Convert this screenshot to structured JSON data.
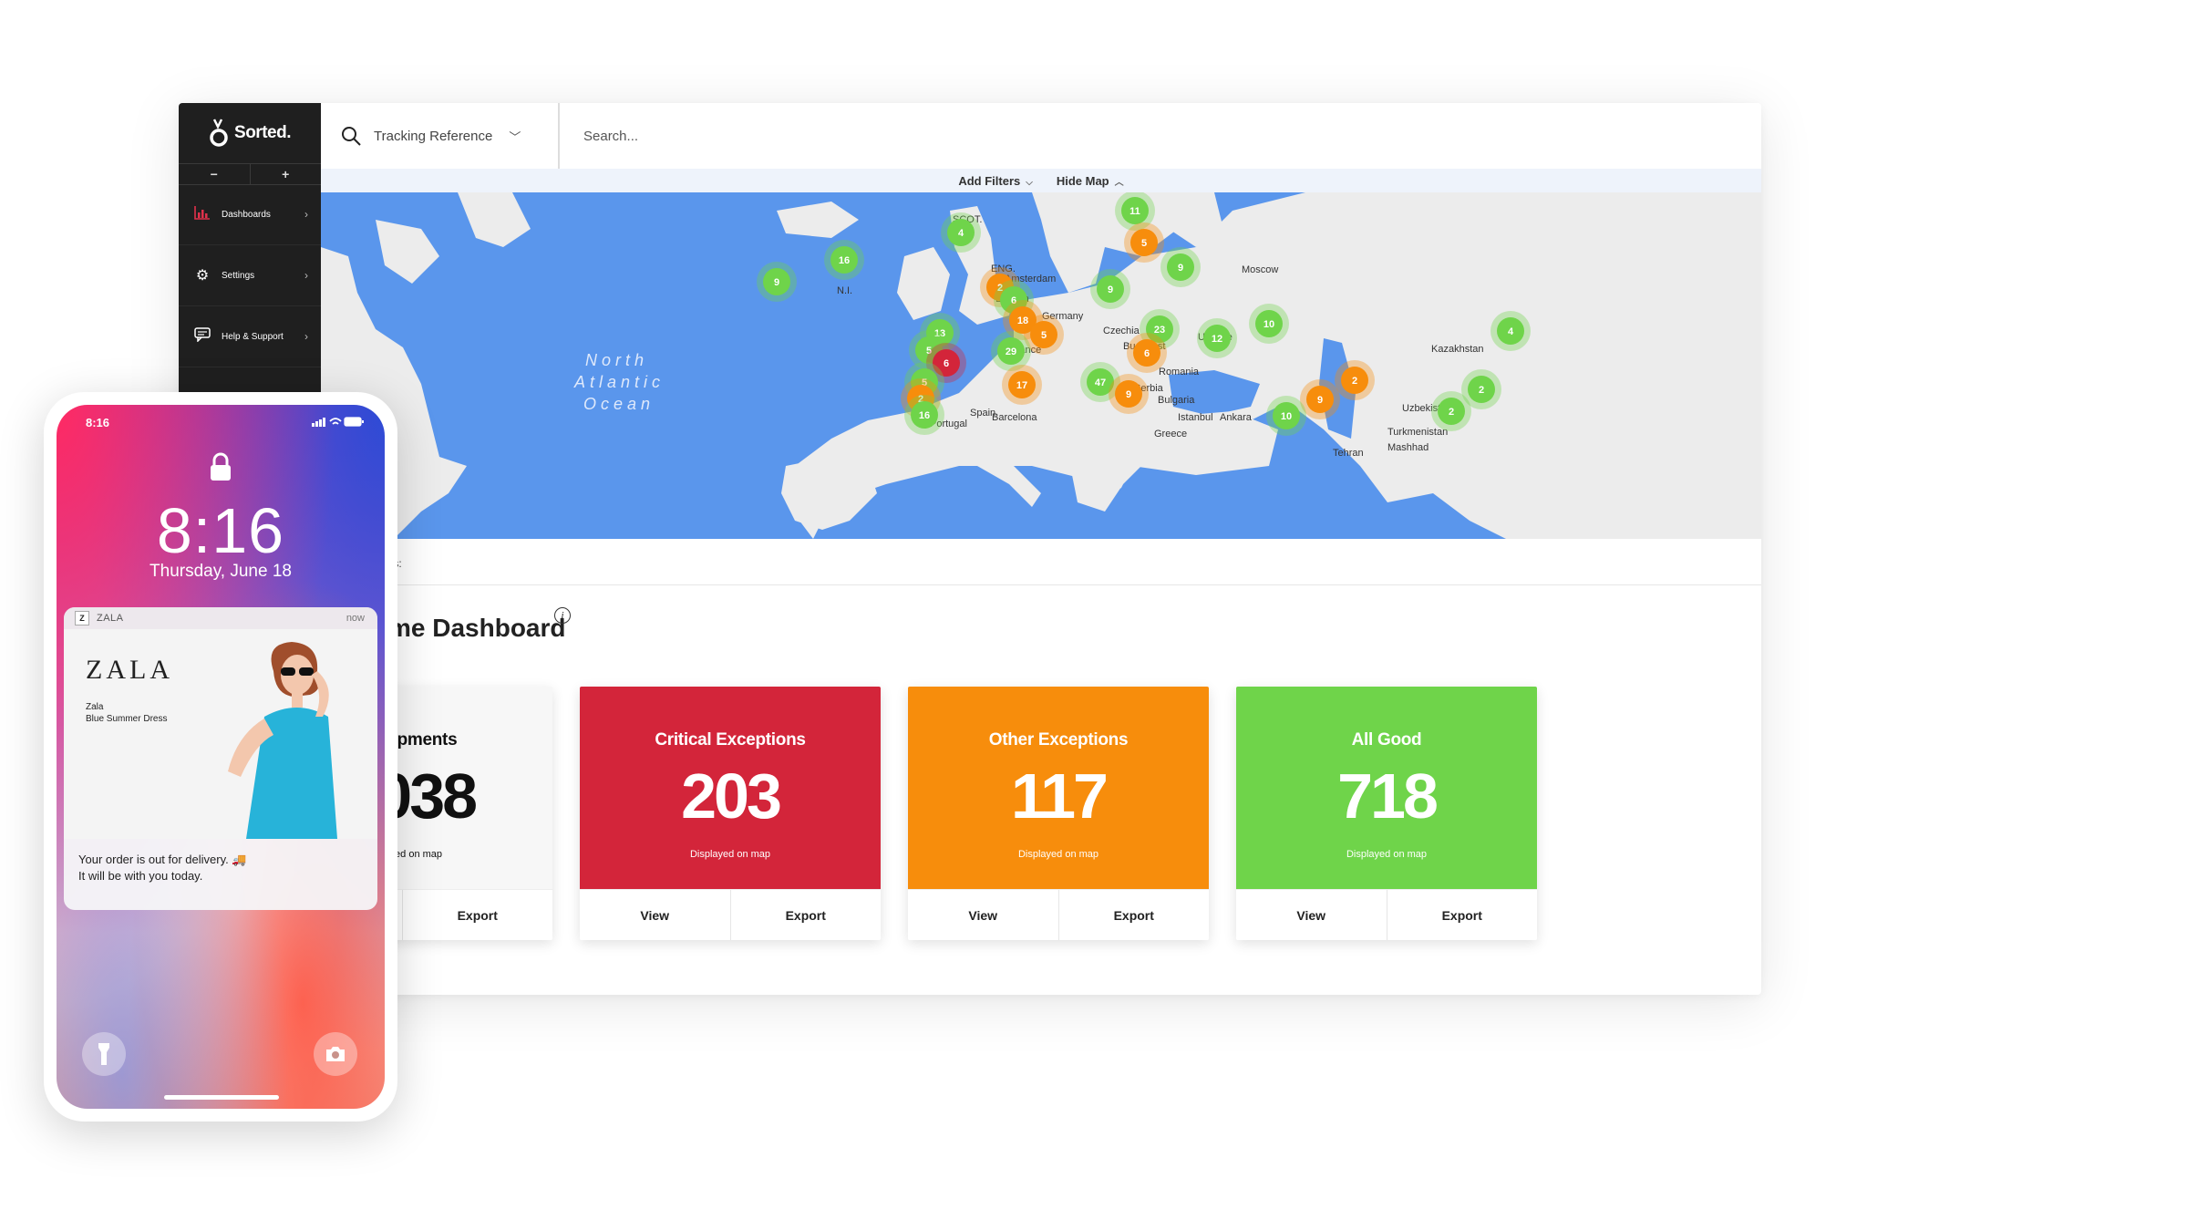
{
  "app": {
    "logo_text": "Sorted.",
    "zoom_out": "−",
    "zoom_in": "+",
    "sidebar": {
      "items": [
        {
          "label": "Dashboards",
          "icon": "bar-chart-icon"
        },
        {
          "label": "Settings",
          "icon": "gear-icon"
        },
        {
          "label": "Help & Support",
          "icon": "chat-icon"
        }
      ]
    },
    "topbar": {
      "tracking_label": "Tracking Reference",
      "search_placeholder": "Search..."
    },
    "filterbar": {
      "add_filters": "Add Filters",
      "hide_map": "Hide Map"
    },
    "map": {
      "ocean_line1": "North",
      "ocean_line2": "Atlantic",
      "ocean_line3": "Ocean",
      "labels": [
        "SCOT.",
        "N.I.",
        "ENG.",
        "London",
        "Amsterdam",
        "France",
        "Germany",
        "Czechia",
        "Budapest",
        "Romania",
        "Ukraine",
        "Moscow",
        "Barcelona",
        "Portugal",
        "Spain",
        "Serbia",
        "Bulgaria",
        "Istanbul",
        "Ankara",
        "Greece",
        "Uzbekistan",
        "Turkmenistan",
        "Mashhad",
        "Tehran",
        "Kazakhstan"
      ],
      "clusters": [
        {
          "value": "4",
          "status": "good"
        },
        {
          "value": "16",
          "status": "good"
        },
        {
          "value": "9",
          "status": "good"
        },
        {
          "value": "11",
          "status": "good"
        },
        {
          "value": "5",
          "status": "other"
        },
        {
          "value": "9",
          "status": "good"
        },
        {
          "value": "2",
          "status": "other"
        },
        {
          "value": "6",
          "status": "good"
        },
        {
          "value": "18",
          "status": "other"
        },
        {
          "value": "5",
          "status": "other"
        },
        {
          "value": "9",
          "status": "good"
        },
        {
          "value": "13",
          "status": "good"
        },
        {
          "value": "23",
          "status": "good"
        },
        {
          "value": "6",
          "status": "other"
        },
        {
          "value": "12",
          "status": "good"
        },
        {
          "value": "10",
          "status": "good"
        },
        {
          "value": "5",
          "status": "good"
        },
        {
          "value": "6",
          "status": "critical"
        },
        {
          "value": "29",
          "status": "good"
        },
        {
          "value": "5",
          "status": "good"
        },
        {
          "value": "17",
          "status": "other"
        },
        {
          "value": "47",
          "status": "good"
        },
        {
          "value": "9",
          "status": "other"
        },
        {
          "value": "2",
          "status": "other"
        },
        {
          "value": "16",
          "status": "good"
        },
        {
          "value": "2",
          "status": "other"
        },
        {
          "value": "9",
          "status": "other"
        },
        {
          "value": "10",
          "status": "good"
        },
        {
          "value": "2",
          "status": "good"
        },
        {
          "value": "2",
          "status": "good"
        },
        {
          "value": "4",
          "status": "good"
        }
      ]
    },
    "filters_label": "ilters:",
    "dashboard_title": "me Dashboard",
    "info_icon": "i",
    "cards": [
      {
        "title": "All shipments",
        "value": "1,038",
        "sub": "Displayed on map",
        "view": "View",
        "export": "Export",
        "bg": "#f7f7f7",
        "fg": "#111111"
      },
      {
        "title": "Critical Exceptions",
        "value": "203",
        "sub": "Displayed on map",
        "view": "View",
        "export": "Export",
        "bg": "#d3253a",
        "fg": "#ffffff"
      },
      {
        "title": "Other Exceptions",
        "value": "117",
        "sub": "Displayed on map",
        "view": "View",
        "export": "Export",
        "bg": "#f78d0c",
        "fg": "#ffffff"
      },
      {
        "title": "All Good",
        "value": "718",
        "sub": "Displayed on map",
        "view": "View",
        "export": "Export",
        "bg": "#6fd44a",
        "fg": "#ffffff"
      }
    ]
  },
  "colors": {
    "good": "#6fd44a",
    "other": "#f78d0c",
    "critical": "#d3253a",
    "ocean": "#5a96ec",
    "land": "#ececec"
  },
  "phone": {
    "status_time": "8:16",
    "lock_time": "8:16",
    "lock_date": "Thursday, June 18",
    "notification": {
      "app_icon": "Z",
      "app": "ZALA",
      "time": "now",
      "brand": "ZALA",
      "product_line1": "Zala",
      "product_line2": "Blue Summer Dress",
      "message_line1": "Your order is out for delivery. 🚚",
      "message_line2": "It will be with you today."
    }
  }
}
